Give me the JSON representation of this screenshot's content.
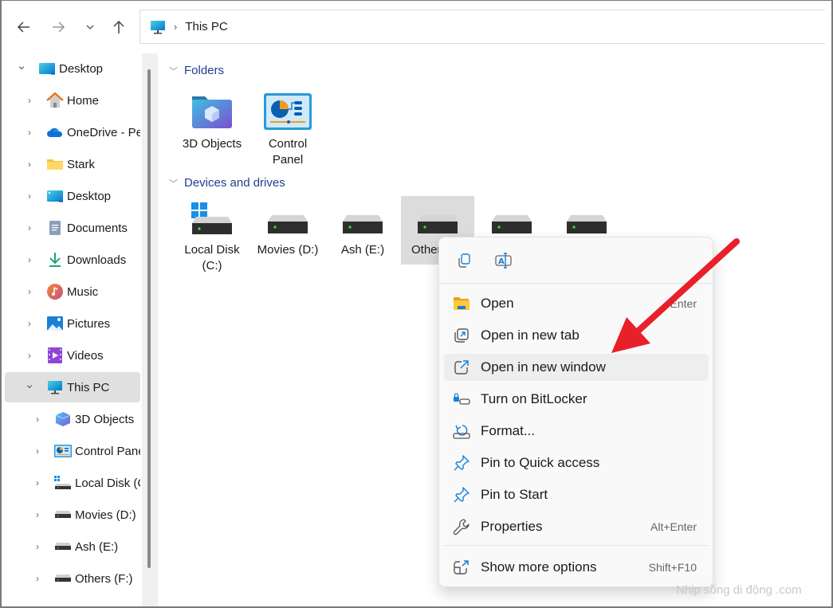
{
  "nav": {
    "back_icon": "arrow-left-icon",
    "forward_icon": "arrow-right-icon",
    "recent_icon": "chevron-down-icon",
    "up_icon": "arrow-up-icon"
  },
  "address": {
    "icon": "this-pc-icon",
    "separator": "›",
    "crumb": "This PC"
  },
  "sidebar": {
    "items": [
      {
        "label": "Desktop",
        "icon": "desktop-icon",
        "expanded": true
      },
      {
        "label": "Home",
        "icon": "home-icon"
      },
      {
        "label": "OneDrive - Personal",
        "icon": "onedrive-icon"
      },
      {
        "label": "Stark",
        "icon": "folder-icon"
      },
      {
        "label": "Desktop",
        "icon": "desktop-folder-icon"
      },
      {
        "label": "Documents",
        "icon": "documents-icon"
      },
      {
        "label": "Downloads",
        "icon": "downloads-icon"
      },
      {
        "label": "Music",
        "icon": "music-icon"
      },
      {
        "label": "Pictures",
        "icon": "pictures-icon"
      },
      {
        "label": "Videos",
        "icon": "videos-icon"
      },
      {
        "label": "This PC",
        "icon": "this-pc-icon",
        "expanded": true,
        "selected": true
      },
      {
        "label": "3D Objects",
        "icon": "3d-objects-icon"
      },
      {
        "label": "Control Panel",
        "icon": "control-panel-icon"
      },
      {
        "label": "Local Disk (C:)",
        "icon": "windows-drive-icon"
      },
      {
        "label": "Movies (D:)",
        "icon": "drive-icon"
      },
      {
        "label": "Ash (E:)",
        "icon": "drive-icon"
      },
      {
        "label": "Others (F:)",
        "icon": "drive-icon"
      }
    ],
    "chevron_right": "›",
    "chevron_down": "⌄"
  },
  "content": {
    "folders_header": "Folders",
    "folders": [
      {
        "label": "3D Objects",
        "icon": "3d-objects-folder-icon"
      },
      {
        "label": "Control Panel",
        "icon": "control-panel-icon"
      }
    ],
    "drives_header": "Devices and drives",
    "drives": [
      {
        "label": "Local Disk (C:)",
        "icon": "windows-drive-icon"
      },
      {
        "label": "Movies (D:)",
        "icon": "drive-icon"
      },
      {
        "label": "Ash (E:)",
        "icon": "drive-icon"
      },
      {
        "label": "Others (F:)",
        "icon": "drive-icon",
        "selected": true
      },
      {
        "label": "",
        "icon": "drive-icon"
      },
      {
        "label": "",
        "icon": "drive-icon"
      }
    ]
  },
  "context_menu": {
    "quick_actions": [
      {
        "name": "copy",
        "icon": "copy-icon"
      },
      {
        "name": "rename",
        "icon": "rename-icon"
      }
    ],
    "items": [
      {
        "label": "Open",
        "shortcut": "Enter",
        "icon": "folder-open-icon"
      },
      {
        "label": "Open in new tab",
        "shortcut": "",
        "icon": "new-tab-icon"
      },
      {
        "label": "Open in new window",
        "shortcut": "",
        "icon": "new-window-icon",
        "hover": true
      },
      {
        "label": "Turn on BitLocker",
        "shortcut": "",
        "icon": "bitlocker-icon"
      },
      {
        "label": "Format...",
        "shortcut": "",
        "icon": "format-icon"
      },
      {
        "label": "Pin to Quick access",
        "shortcut": "",
        "icon": "pin-icon"
      },
      {
        "label": "Pin to Start",
        "shortcut": "",
        "icon": "pin-icon"
      },
      {
        "label": "Properties",
        "shortcut": "Alt+Enter",
        "icon": "wrench-icon"
      },
      {
        "label": "Show more options",
        "shortcut": "Shift+F10",
        "icon": "more-options-icon"
      }
    ]
  },
  "annotation": {
    "color": "#e8202a",
    "target": "Open in new window"
  },
  "watermark": "Nhịp sống di động .com"
}
